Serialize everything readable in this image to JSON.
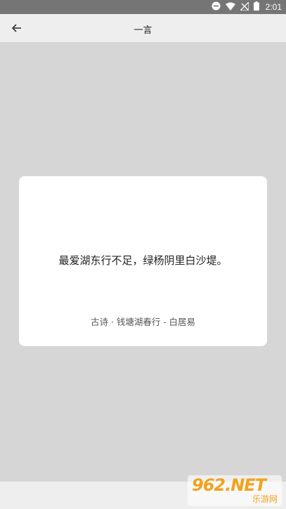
{
  "statusbar": {
    "time": "2:01",
    "icons": [
      "do-not-disturb-icon",
      "wifi-icon",
      "no-signal-icon",
      "battery-icon"
    ]
  },
  "appbar": {
    "title": "一言",
    "back_icon": "arrow-back-icon"
  },
  "card": {
    "quote": "最爱湖东行不足，绿杨阴里白沙堤。",
    "source": "古诗 · 钱塘湖春行 - 白居易"
  },
  "watermark": {
    "main": "962.NET",
    "sub": "乐游网"
  },
  "colors": {
    "statusbar_bg": "#757575",
    "appbar_bg": "#eeeeee",
    "content_bg": "#d6d6d6",
    "card_bg": "#ffffff",
    "watermark": "#f2a21c"
  }
}
